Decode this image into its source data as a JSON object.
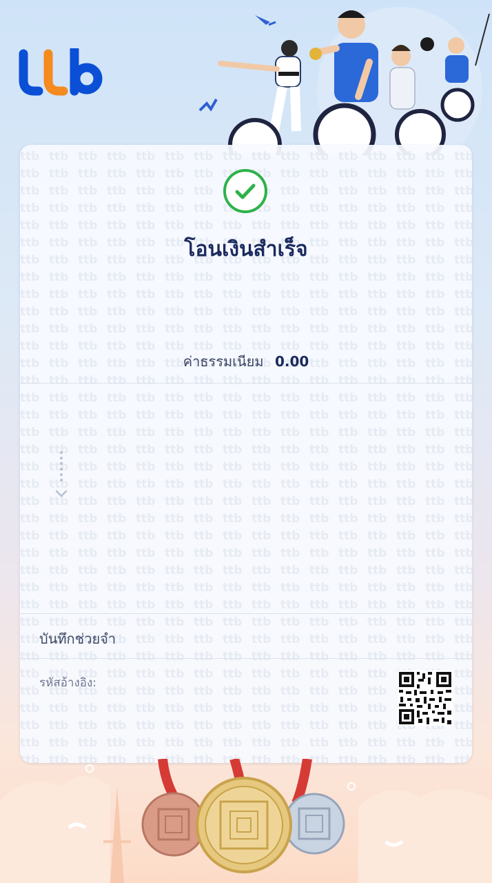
{
  "brand": {
    "logo_text": "ttb"
  },
  "status": {
    "icon": "check-circle-icon",
    "title": "โอนเงินสำเร็จ",
    "color": "#2eb24a"
  },
  "fee": {
    "label": "ค่าธรรมเนียม",
    "value": "0.00"
  },
  "details": {
    "expand_icon": "chevron-down-icon"
  },
  "memo": {
    "label": "บันทึกช่วยจำ"
  },
  "reference": {
    "label": "รหัสอ้างอิง:",
    "qr_icon": "qr-code-icon"
  },
  "colors": {
    "primary": "#1b2a5e",
    "brand_blue": "#0a4fd6",
    "brand_orange": "#f58a1f"
  }
}
